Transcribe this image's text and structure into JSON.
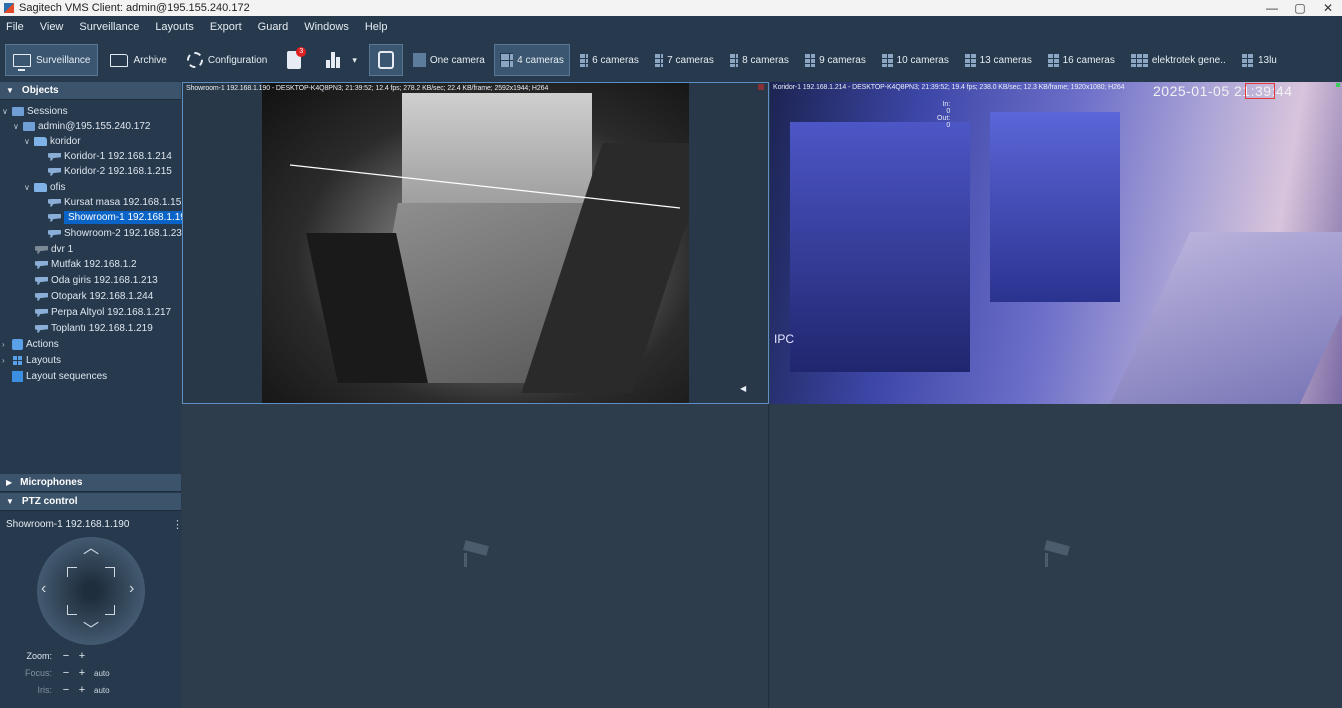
{
  "window": {
    "title": "Sagitech VMS Client: admin@195.155.240.172",
    "controls": [
      "—",
      "▢",
      "✕"
    ]
  },
  "menu": [
    "File",
    "View",
    "Surveillance",
    "Layouts",
    "Export",
    "Guard",
    "Windows",
    "Help"
  ],
  "toolbar": {
    "surveillance": "Surveillance",
    "archive": "Archive",
    "configuration": "Configuration",
    "notifications_count": "3",
    "stats_dropdown": "▾",
    "layouts": [
      {
        "label": "One camera",
        "active": false
      },
      {
        "label": "4 cameras",
        "active": true
      },
      {
        "label": "6 cameras",
        "active": false
      },
      {
        "label": "7 cameras",
        "active": false
      },
      {
        "label": "8 cameras",
        "active": false
      },
      {
        "label": "9 cameras",
        "active": false
      },
      {
        "label": "10 cameras",
        "active": false
      },
      {
        "label": "13 cameras",
        "active": false
      },
      {
        "label": "16 cameras",
        "active": false
      },
      {
        "label": "elektrotek gene..",
        "active": false
      },
      {
        "label": "13lu",
        "active": false
      }
    ]
  },
  "sidebar": {
    "objects_title": "Objects",
    "tree": {
      "sessions": "Sessions",
      "server": "admin@195.155.240.172",
      "koridor": "koridor",
      "koridor1": "Koridor-1 192.168.1.214",
      "koridor2": "Koridor-2 192.168.1.215",
      "ofis": "ofis",
      "kursat": "Kursat masa 192.168.1.15",
      "showroom1": "Showroom-1 192.168.1.190",
      "showroom2": "Showroom-2 192.168.1.235",
      "dvr": "dvr 1",
      "mutfak": "Mutfak 192.168.1.2",
      "oda": "Oda giris 192.168.1.213",
      "otopark": "Otopark 192.168.1.244",
      "perpa": "Perpa Altyol 192.168.1.217",
      "toplanti": "Toplantı 192.168.1.219",
      "actions": "Actions",
      "layouts": "Layouts",
      "layout_sequences": "Layout sequences"
    },
    "microphones_title": "Microphones",
    "ptz_title": "PTZ control",
    "ptz": {
      "camera": "Showroom-1 192.168.1.190",
      "zoom": "Zoom:",
      "focus": "Focus:",
      "iris": "Iris:",
      "minus": "−",
      "plus": "+",
      "auto": "auto"
    }
  },
  "cells": {
    "cam1_info": "Showroom-1 192.168.1.190 - DESKTOP-K4Q8PN3; 21:39:52; 12.4 fps; 278.2 KB/sec; 22.4 KB/frame; 2592x1944; H264",
    "cam1_in": "In: 0",
    "cam1_out": "Out: 0",
    "cam2_info": "Koridor-1 192.168.1.214 - DESKTOP-K4Q8PN3; 21:39:52; 19.4 fps; 238.0 KB/sec; 12.3 KB/frame; 1920x1080; H264",
    "cam2_timestamp": "2025-01-05 21:39:44",
    "cam2_overlay": "IPC"
  },
  "colors": {
    "accent": "#0a64c8",
    "selection_border": "#5c8fc4",
    "badge": "#e02020"
  }
}
